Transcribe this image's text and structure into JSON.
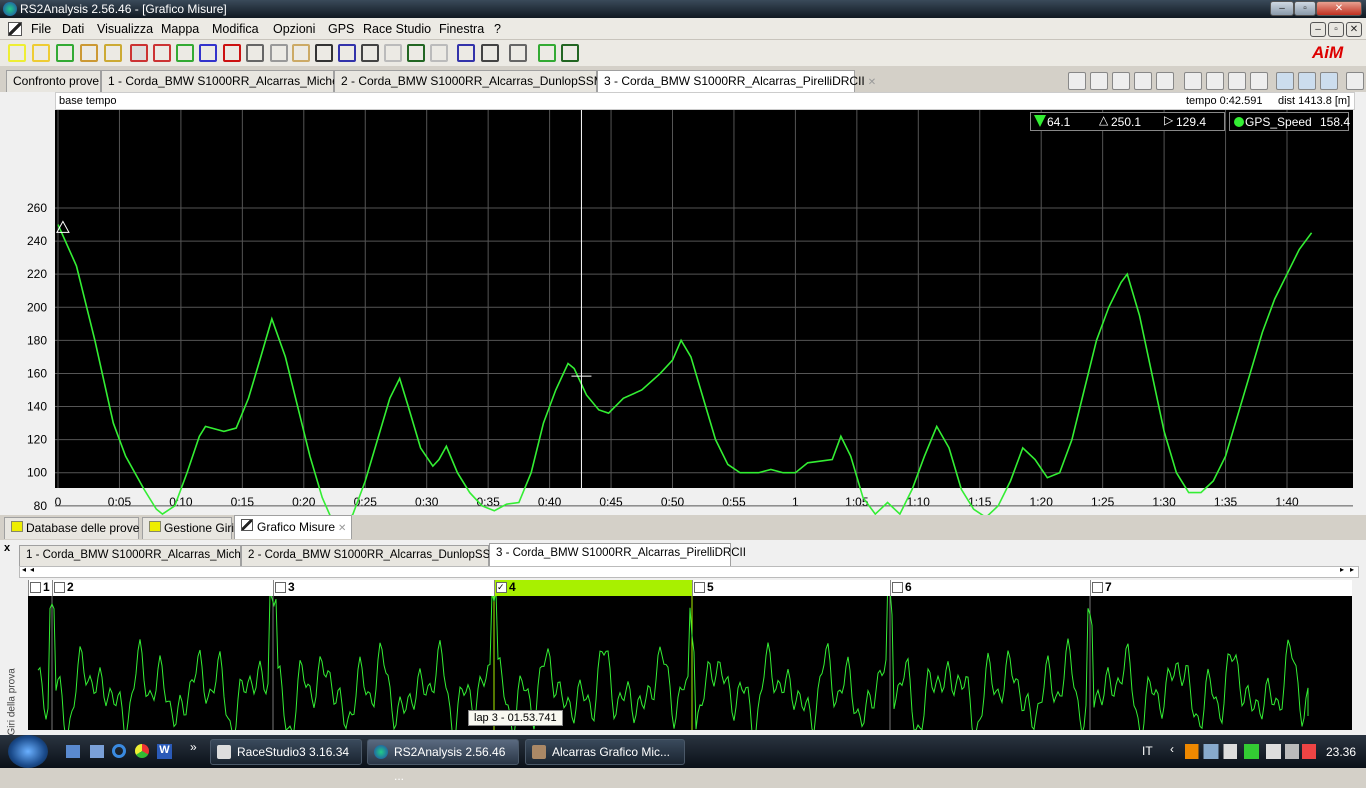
{
  "window": {
    "title": "RS2Analysis 2.56.46 - [Grafico Misure]"
  },
  "menu": [
    "File",
    "Dati",
    "Visualizza",
    "Mappa",
    "Modifica",
    "Opzioni",
    "GPS",
    "Race Studio",
    "Finestra",
    "?"
  ],
  "brand": "AiM",
  "toolbar_icons": [
    "open-folder-icon",
    "open-file-icon",
    "download-icon",
    "import-icon",
    "help-icon",
    "graph-edit-icon",
    "curve-icon",
    "xy-graph-icon",
    "gps-icon",
    "histogram-icon",
    "report-icon",
    "table-icon",
    "split-icon",
    "gauge-icon",
    "pen-icon",
    "channel-icon",
    "track-icon",
    "film-icon",
    "map-icon",
    "preview-icon",
    "print-icon",
    "math-icon",
    "compare-icon",
    "layout-icon"
  ],
  "top_tabs": [
    {
      "label": "Confronto prove",
      "closable": false
    },
    {
      "label": "1 - Corda_BMW S1000RR_Alcarras_Michelin",
      "closable": true
    },
    {
      "label": "2 - Corda_BMW S1000RR_Alcarras_DunlopSSMTT",
      "closable": true
    },
    {
      "label": "3 - Corda_BMW S1000RR_Alcarras_PirelliDRCII",
      "closable": true,
      "active": true
    }
  ],
  "chart_header": {
    "base": "base tempo",
    "time": "tempo 0:42.591",
    "dist": "dist 1413.8 [m]"
  },
  "legend": {
    "min": "64.1",
    "max": "250.1",
    "cursor": "129.4",
    "channel": "GPS_Speed",
    "channel_value": "158.4",
    "color": "#33ee33"
  },
  "chart_data": {
    "type": "line",
    "ylabel": "km/h",
    "ylim": [
      40,
      260
    ],
    "yticks": [
      40,
      60,
      80,
      100,
      120,
      140,
      160,
      180,
      200,
      220,
      240,
      260
    ],
    "xlim": [
      0,
      104
    ],
    "xticks": [
      {
        "v": 0,
        "l": "0"
      },
      {
        "v": 5,
        "l": "0:05"
      },
      {
        "v": 10,
        "l": "0:10"
      },
      {
        "v": 15,
        "l": "0:15"
      },
      {
        "v": 20,
        "l": "0:20"
      },
      {
        "v": 25,
        "l": "0:25"
      },
      {
        "v": 30,
        "l": "0:30"
      },
      {
        "v": 35,
        "l": "0:35"
      },
      {
        "v": 40,
        "l": "0:40"
      },
      {
        "v": 45,
        "l": "0:45"
      },
      {
        "v": 50,
        "l": "0:50"
      },
      {
        "v": 55,
        "l": "0:55"
      },
      {
        "v": 60,
        "l": "1"
      },
      {
        "v": 65,
        "l": "1:05"
      },
      {
        "v": 70,
        "l": "1:10"
      },
      {
        "v": 75,
        "l": "1:15"
      },
      {
        "v": 80,
        "l": "1:20"
      },
      {
        "v": 85,
        "l": "1:25"
      },
      {
        "v": 90,
        "l": "1:30"
      },
      {
        "v": 95,
        "l": "1:35"
      },
      {
        "v": 100,
        "l": "1:40"
      }
    ],
    "grid": true,
    "cursor_time": 42.591,
    "min_point": [
      23,
      64.1
    ],
    "max_point": [
      0.4,
      250.1
    ],
    "series": [
      {
        "name": "GPS_Speed",
        "color": "#33ee33",
        "points": [
          [
            0,
            250
          ],
          [
            1.5,
            225
          ],
          [
            3,
            180
          ],
          [
            4.5,
            130
          ],
          [
            5.5,
            110
          ],
          [
            7,
            90
          ],
          [
            8,
            78
          ],
          [
            8.5,
            75
          ],
          [
            9.5,
            80
          ],
          [
            10.5,
            100
          ],
          [
            11.5,
            122
          ],
          [
            12,
            128
          ],
          [
            13.5,
            125
          ],
          [
            14.5,
            127
          ],
          [
            15.5,
            145
          ],
          [
            16.5,
            170
          ],
          [
            17.4,
            193
          ],
          [
            18.5,
            170
          ],
          [
            19.5,
            140
          ],
          [
            20.5,
            110
          ],
          [
            21.5,
            85
          ],
          [
            22.5,
            68
          ],
          [
            23,
            64
          ],
          [
            24,
            75
          ],
          [
            25,
            95
          ],
          [
            26,
            120
          ],
          [
            27,
            145
          ],
          [
            27.8,
            157
          ],
          [
            28.5,
            140
          ],
          [
            29.5,
            115
          ],
          [
            30.5,
            104
          ],
          [
            31,
            108
          ],
          [
            31.6,
            116
          ],
          [
            32.5,
            100
          ],
          [
            33.5,
            88
          ],
          [
            34.5,
            80
          ],
          [
            35.5,
            77
          ],
          [
            36.5,
            81
          ],
          [
            37.5,
            82
          ],
          [
            38.5,
            100
          ],
          [
            39.5,
            130
          ],
          [
            40.5,
            150
          ],
          [
            41.5,
            166
          ],
          [
            42,
            163
          ],
          [
            43,
            147
          ],
          [
            44,
            138
          ],
          [
            44.8,
            136
          ],
          [
            46,
            145
          ],
          [
            47.5,
            150
          ],
          [
            49,
            160
          ],
          [
            50,
            168
          ],
          [
            50.7,
            180
          ],
          [
            51.5,
            170
          ],
          [
            52.5,
            145
          ],
          [
            53.5,
            120
          ],
          [
            54.5,
            105
          ],
          [
            55.5,
            100
          ],
          [
            57,
            100
          ],
          [
            58,
            102
          ],
          [
            59,
            100
          ],
          [
            60,
            100
          ],
          [
            61,
            106
          ],
          [
            62,
            107
          ],
          [
            63,
            108
          ],
          [
            63.7,
            122
          ],
          [
            64.5,
            110
          ],
          [
            65.5,
            85
          ],
          [
            66.5,
            75
          ],
          [
            67.5,
            82
          ],
          [
            68.5,
            75
          ],
          [
            69.5,
            90
          ],
          [
            70.5,
            110
          ],
          [
            71.5,
            128
          ],
          [
            72.5,
            115
          ],
          [
            73.5,
            90
          ],
          [
            74.5,
            78
          ],
          [
            75.5,
            73
          ],
          [
            76.5,
            80
          ],
          [
            77.5,
            95
          ],
          [
            78.5,
            115
          ],
          [
            79.5,
            108
          ],
          [
            80.5,
            97
          ],
          [
            81.5,
            100
          ],
          [
            82.5,
            120
          ],
          [
            83.5,
            150
          ],
          [
            84.5,
            180
          ],
          [
            85.5,
            200
          ],
          [
            86.5,
            215
          ],
          [
            87,
            220
          ],
          [
            88,
            195
          ],
          [
            89,
            160
          ],
          [
            90,
            125
          ],
          [
            91,
            100
          ],
          [
            92,
            88
          ],
          [
            93,
            88
          ],
          [
            94,
            95
          ],
          [
            95,
            110
          ],
          [
            96,
            135
          ],
          [
            97,
            160
          ],
          [
            98,
            185
          ],
          [
            99,
            205
          ],
          [
            100,
            220
          ],
          [
            101,
            235
          ],
          [
            102,
            245
          ]
        ]
      }
    ]
  },
  "bottom_tabs": [
    {
      "label": "Database delle prove"
    },
    {
      "label": "Gestione Giri"
    },
    {
      "label": "Grafico Misure",
      "active": true,
      "closable": true
    }
  ],
  "lower": {
    "close": "x",
    "side_label": "Giri della prova",
    "tabs": [
      "1 - Corda_BMW S1000RR_Alcarras_Michelin",
      "2 - Corda_BMW S1000RR_Alcarras_DunlopSSMTT",
      "3 - Corda_BMW S1000RR_Alcarras_PirelliDRCII"
    ],
    "laps": [
      {
        "n": "1",
        "checked": false
      },
      {
        "n": "2",
        "checked": false
      },
      {
        "n": "3",
        "checked": false
      },
      {
        "n": "4",
        "checked": true,
        "selected": true
      },
      {
        "n": "5",
        "checked": false
      },
      {
        "n": "6",
        "checked": false
      },
      {
        "n": "7",
        "checked": false
      }
    ],
    "tooltip": "lap 3 - 01.53.741",
    "selected_color": "#a8f000"
  },
  "taskbar": {
    "tasks": [
      {
        "label": "RaceStudio3 3.16.34"
      },
      {
        "label": "RS2Analysis 2.56.46 ...",
        "active": true
      },
      {
        "label": "Alcarras Grafico Mic..."
      }
    ],
    "lang": "IT",
    "clock": "23.36",
    "more": "»"
  }
}
